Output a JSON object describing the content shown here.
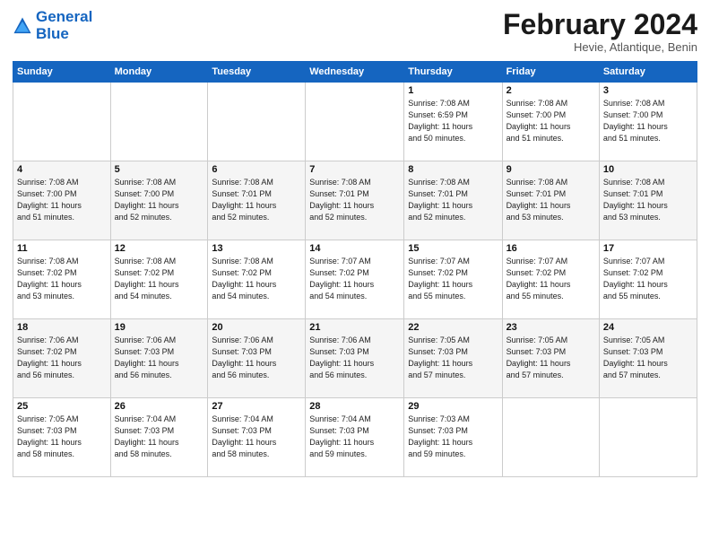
{
  "header": {
    "logo_line1": "General",
    "logo_line2": "Blue",
    "month": "February 2024",
    "location": "Hevie, Atlantique, Benin"
  },
  "days_of_week": [
    "Sunday",
    "Monday",
    "Tuesday",
    "Wednesday",
    "Thursday",
    "Friday",
    "Saturday"
  ],
  "weeks": [
    [
      {
        "day": "",
        "info": ""
      },
      {
        "day": "",
        "info": ""
      },
      {
        "day": "",
        "info": ""
      },
      {
        "day": "",
        "info": ""
      },
      {
        "day": "1",
        "info": "Sunrise: 7:08 AM\nSunset: 6:59 PM\nDaylight: 11 hours\nand 50 minutes."
      },
      {
        "day": "2",
        "info": "Sunrise: 7:08 AM\nSunset: 7:00 PM\nDaylight: 11 hours\nand 51 minutes."
      },
      {
        "day": "3",
        "info": "Sunrise: 7:08 AM\nSunset: 7:00 PM\nDaylight: 11 hours\nand 51 minutes."
      }
    ],
    [
      {
        "day": "4",
        "info": "Sunrise: 7:08 AM\nSunset: 7:00 PM\nDaylight: 11 hours\nand 51 minutes."
      },
      {
        "day": "5",
        "info": "Sunrise: 7:08 AM\nSunset: 7:00 PM\nDaylight: 11 hours\nand 52 minutes."
      },
      {
        "day": "6",
        "info": "Sunrise: 7:08 AM\nSunset: 7:01 PM\nDaylight: 11 hours\nand 52 minutes."
      },
      {
        "day": "7",
        "info": "Sunrise: 7:08 AM\nSunset: 7:01 PM\nDaylight: 11 hours\nand 52 minutes."
      },
      {
        "day": "8",
        "info": "Sunrise: 7:08 AM\nSunset: 7:01 PM\nDaylight: 11 hours\nand 52 minutes."
      },
      {
        "day": "9",
        "info": "Sunrise: 7:08 AM\nSunset: 7:01 PM\nDaylight: 11 hours\nand 53 minutes."
      },
      {
        "day": "10",
        "info": "Sunrise: 7:08 AM\nSunset: 7:01 PM\nDaylight: 11 hours\nand 53 minutes."
      }
    ],
    [
      {
        "day": "11",
        "info": "Sunrise: 7:08 AM\nSunset: 7:02 PM\nDaylight: 11 hours\nand 53 minutes."
      },
      {
        "day": "12",
        "info": "Sunrise: 7:08 AM\nSunset: 7:02 PM\nDaylight: 11 hours\nand 54 minutes."
      },
      {
        "day": "13",
        "info": "Sunrise: 7:08 AM\nSunset: 7:02 PM\nDaylight: 11 hours\nand 54 minutes."
      },
      {
        "day": "14",
        "info": "Sunrise: 7:07 AM\nSunset: 7:02 PM\nDaylight: 11 hours\nand 54 minutes."
      },
      {
        "day": "15",
        "info": "Sunrise: 7:07 AM\nSunset: 7:02 PM\nDaylight: 11 hours\nand 55 minutes."
      },
      {
        "day": "16",
        "info": "Sunrise: 7:07 AM\nSunset: 7:02 PM\nDaylight: 11 hours\nand 55 minutes."
      },
      {
        "day": "17",
        "info": "Sunrise: 7:07 AM\nSunset: 7:02 PM\nDaylight: 11 hours\nand 55 minutes."
      }
    ],
    [
      {
        "day": "18",
        "info": "Sunrise: 7:06 AM\nSunset: 7:02 PM\nDaylight: 11 hours\nand 56 minutes."
      },
      {
        "day": "19",
        "info": "Sunrise: 7:06 AM\nSunset: 7:03 PM\nDaylight: 11 hours\nand 56 minutes."
      },
      {
        "day": "20",
        "info": "Sunrise: 7:06 AM\nSunset: 7:03 PM\nDaylight: 11 hours\nand 56 minutes."
      },
      {
        "day": "21",
        "info": "Sunrise: 7:06 AM\nSunset: 7:03 PM\nDaylight: 11 hours\nand 56 minutes."
      },
      {
        "day": "22",
        "info": "Sunrise: 7:05 AM\nSunset: 7:03 PM\nDaylight: 11 hours\nand 57 minutes."
      },
      {
        "day": "23",
        "info": "Sunrise: 7:05 AM\nSunset: 7:03 PM\nDaylight: 11 hours\nand 57 minutes."
      },
      {
        "day": "24",
        "info": "Sunrise: 7:05 AM\nSunset: 7:03 PM\nDaylight: 11 hours\nand 57 minutes."
      }
    ],
    [
      {
        "day": "25",
        "info": "Sunrise: 7:05 AM\nSunset: 7:03 PM\nDaylight: 11 hours\nand 58 minutes."
      },
      {
        "day": "26",
        "info": "Sunrise: 7:04 AM\nSunset: 7:03 PM\nDaylight: 11 hours\nand 58 minutes."
      },
      {
        "day": "27",
        "info": "Sunrise: 7:04 AM\nSunset: 7:03 PM\nDaylight: 11 hours\nand 58 minutes."
      },
      {
        "day": "28",
        "info": "Sunrise: 7:04 AM\nSunset: 7:03 PM\nDaylight: 11 hours\nand 59 minutes."
      },
      {
        "day": "29",
        "info": "Sunrise: 7:03 AM\nSunset: 7:03 PM\nDaylight: 11 hours\nand 59 minutes."
      },
      {
        "day": "",
        "info": ""
      },
      {
        "day": "",
        "info": ""
      }
    ]
  ]
}
